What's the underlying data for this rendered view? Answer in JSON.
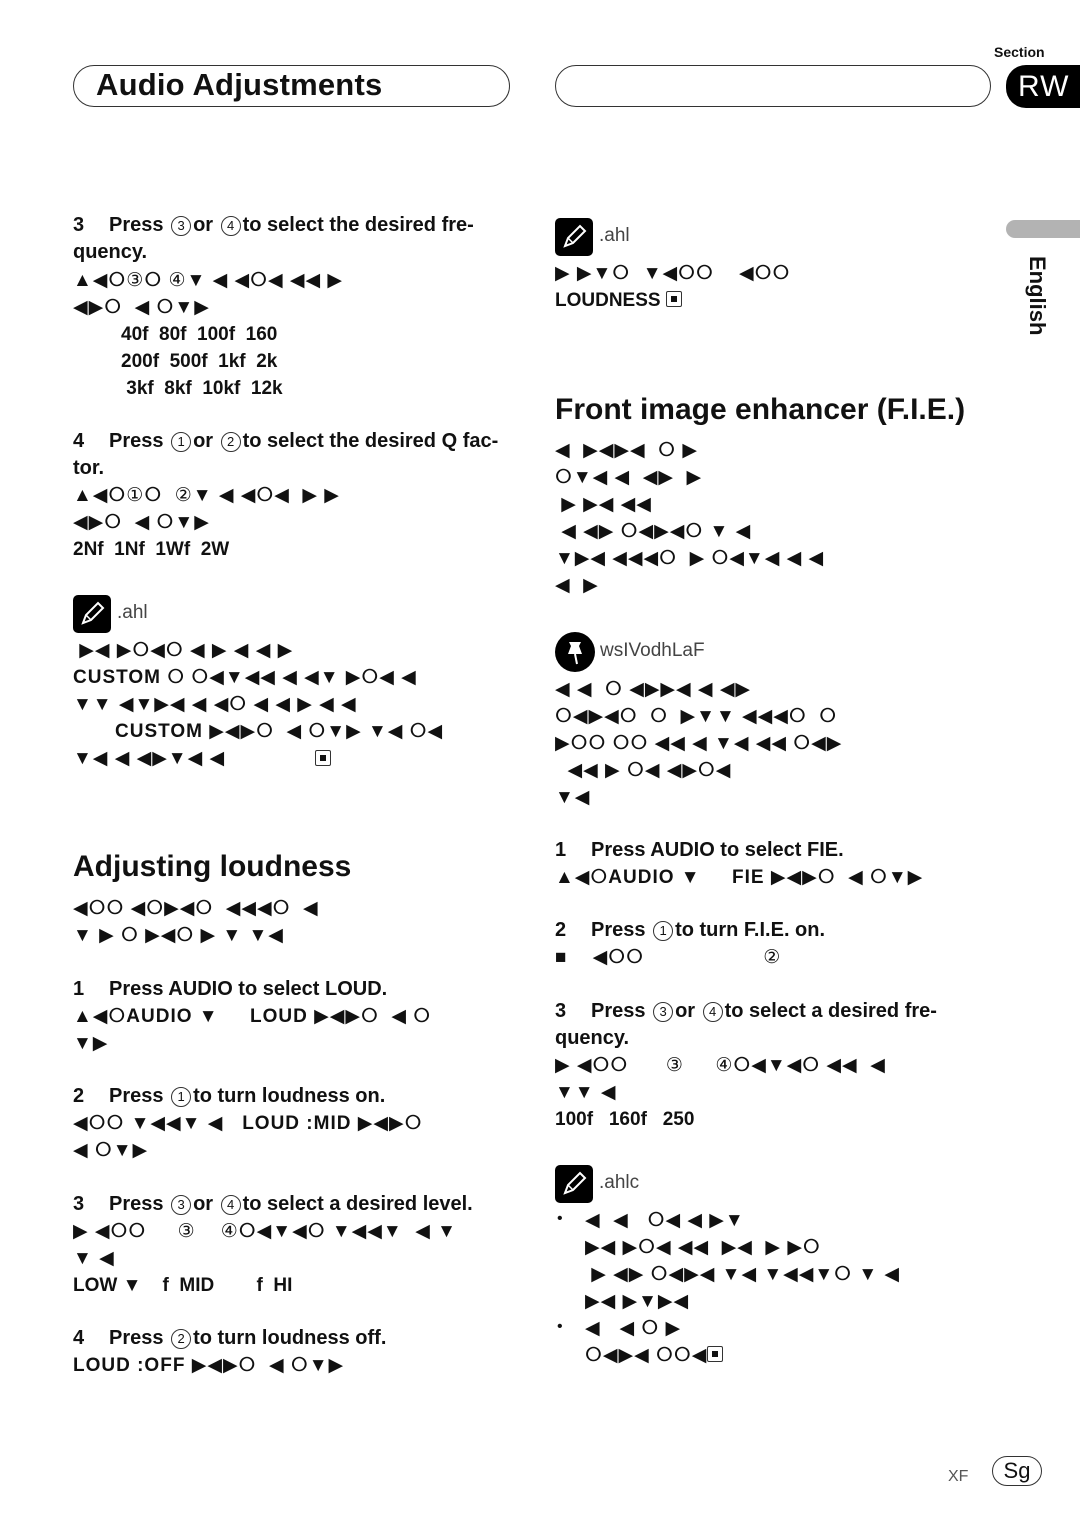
{
  "header": {
    "title": "Audio Adjustments",
    "section_label": "Section",
    "section_number": "RW",
    "language_tab": "English"
  },
  "left_column": {
    "step3_freq": {
      "number": "3",
      "text_before": "Press",
      "btn_a": "3",
      "mid": "or",
      "btn_b": "4",
      "text_after": "to select the desired fre-",
      "text_line2": "quency.",
      "garbled_line1": "▲◀ⵔ③ⵔ ④▼ ◀ ◀ⵔ◀ ◀◀ ▶",
      "garbled_line2": "◀▶ⵔ  ◀ ⵔ▼▶",
      "freq_row1": "40f  80f  100f  160",
      "freq_row2": "200f  500f  1kf  2k",
      "freq_row3": " 3kf  8kf  10kf  12k"
    },
    "step4_q": {
      "number": "4",
      "text_before": "Press",
      "btn_a": "1",
      "mid": "or",
      "btn_b": "2",
      "text_after": "to select the desired Q fac-",
      "text_line2": "tor.",
      "garbled_line1": "▲◀ⵔ①ⵔ  ②▼ ◀ ◀ⵔ◀  ▶ ▶",
      "garbled_line2": "◀▶ⵔ  ◀ ⵔ▼▶",
      "q_values": "2Nf  1Nf  1Wf  2W"
    },
    "note1": {
      "label": ".ahl",
      "line1": " ▶◀ ▶ⵔ◀ⵔ ◀ ▶ ◀ ◀ ▶",
      "line2_bold": "CUSTOM",
      "line2": " ⵔ ⵔ◀▼◀◀ ◀ ◀▼ ▶ⵔ◀ ◀",
      "line3": "▼▼ ◀▼▶◀ ◀ ◀ⵔ ◀ ◀ ▶ ◀ ◀",
      "line4_bold": "CUSTOM",
      "line4": " ▶◀▶ⵔ  ◀ ⵔ▼▶ ▼◀ ⵔ◀",
      "line5": "▼◀ ◀ ◀▶▼◀ ◀"
    },
    "loudness": {
      "heading": "Adjusting loudness",
      "intro_line1": "◀ⵔⵔ ◀ⵔ▶◀ⵔ  ◀◀◀ⵔ  ◀",
      "intro_line2": "▼ ▶ ⵔ ▶◀ⵔ ▶ ▼ ▼◀",
      "step1": {
        "number": "1",
        "text": "Press AUDIO to select LOUD.",
        "line1_pre": "▲◀ⵔ",
        "line1_bold1": "AUDIO",
        "line1_mid": " ▼     ",
        "line1_bold2": "LOUD",
        "line1_post": " ▶◀▶ⵔ  ◀ ⵔ",
        "line2": "▼▶"
      },
      "step2": {
        "number": "2",
        "text_before": "Press",
        "btn": "1",
        "text_after": "to turn loudness on.",
        "line1_pre": "◀ⵔⵔ ▼◀◀▼ ◀   ",
        "line1_bold": "LOUD :MID",
        "line1_post": " ▶◀▶ⵔ",
        "line2": "◀ ⵔ▼▶"
      },
      "step3": {
        "number": "3",
        "text_before": "Press",
        "btn_a": "3",
        "mid": "or",
        "btn_b": "4",
        "text_after": "to select a desired level.",
        "line1": "▶ ◀ⵔⵔ     ③    ④ⵔ◀▼◀ⵔ ▼◀◀▼  ◀ ▼",
        "line2": "▼ ◀",
        "levels": "LOW ▼    f  MID        f  HI"
      },
      "step4": {
        "number": "4",
        "text_before": "Press",
        "btn": "2",
        "text_after": "to turn loudness off.",
        "line1_bold": "LOUD :OFF",
        "line1_post": " ▶◀▶ⵔ  ◀ ⵔ▼▶"
      }
    }
  },
  "right_column": {
    "note_top": {
      "label": ".ahl",
      "line1": "▶ ▶▼ⵔ  ▼◀ⵔⵔ    ◀ⵔⵔ",
      "line2_bold": "LOUDNESS"
    },
    "fie": {
      "heading": "Front image enhancer (F.I.E.)",
      "intro": [
        "◀  ▶◀▶◀  ⵔ ▶",
        "ⵔ▼◀ ◀  ◀▶  ▶",
        " ▶ ▶◀ ◀◀",
        " ◀ ◀▶ ⵔ◀▶◀ⵔ ▼ ◀",
        "▼▶◀ ◀◀◀ⵔ  ▶ ⵔ◀▼◀ ◀ ◀",
        "◀  ▶"
      ],
      "important": {
        "label": "wsIVodhLaF",
        "lines": [
          "◀ ◀  ⵔ ◀▶▶◀ ◀ ◀▶",
          "ⵔ◀▶◀ⵔ  ⵔ  ▶▼▼ ◀◀◀ⵔ  ⵔ",
          "▶ⵔⵔ ⵔⵔ ◀◀ ◀ ▼◀ ◀◀ ⵔ◀▶",
          "  ◀◀ ▶ ⵔ◀ ◀▶ⵔ◀",
          "▼◀"
        ]
      },
      "step1": {
        "number": "1",
        "text": "Press AUDIO to select FIE.",
        "line1_pre": "▲◀ⵔ",
        "line1_bold1": "AUDIO",
        "line1_mid": " ▼     ",
        "line1_bold2": "FIE",
        "line1_post": " ▶◀▶ⵔ  ◀ ⵔ▼▶"
      },
      "step2": {
        "number": "2",
        "text_before": "Press",
        "btn": "1",
        "text_after": "to turn F.I.E. on.",
        "line1": "■    ◀ⵔⵔ                   ②"
      },
      "step3": {
        "number": "3",
        "text_before": "Press",
        "btn_a": "3",
        "mid": "or",
        "btn_b": "4",
        "text_after": "to select a desired fre-",
        "text_line2": "quency.",
        "line1": "▶ ◀ⵔⵔ      ③     ④ⵔ◀▼◀ⵔ ◀◀  ◀",
        "line2": "▼▼ ◀",
        "freqs": "100f   160f   250"
      },
      "notes": {
        "label": ".ahlc",
        "bullets": [
          {
            "lines": [
              "◀  ◀   ⵔ◀ ◀ ▶▼",
              "▶◀ ▶ⵔ◀ ◀◀  ▶◀  ▶ ▶ⵔ",
              " ▶ ◀▶ ⵔ◀▶◀ ▼◀ ▼◀◀▼ⵔ ▼ ◀",
              "▶◀ ▶▼▶◀"
            ]
          },
          {
            "lines": [
              "◀   ◀ ⵔ ▶",
              "ⵔ◀▶◀ ⵔⵔ◀"
            ]
          }
        ]
      }
    }
  },
  "footer": {
    "page_prefix": "XF",
    "page_number": "Sg"
  }
}
